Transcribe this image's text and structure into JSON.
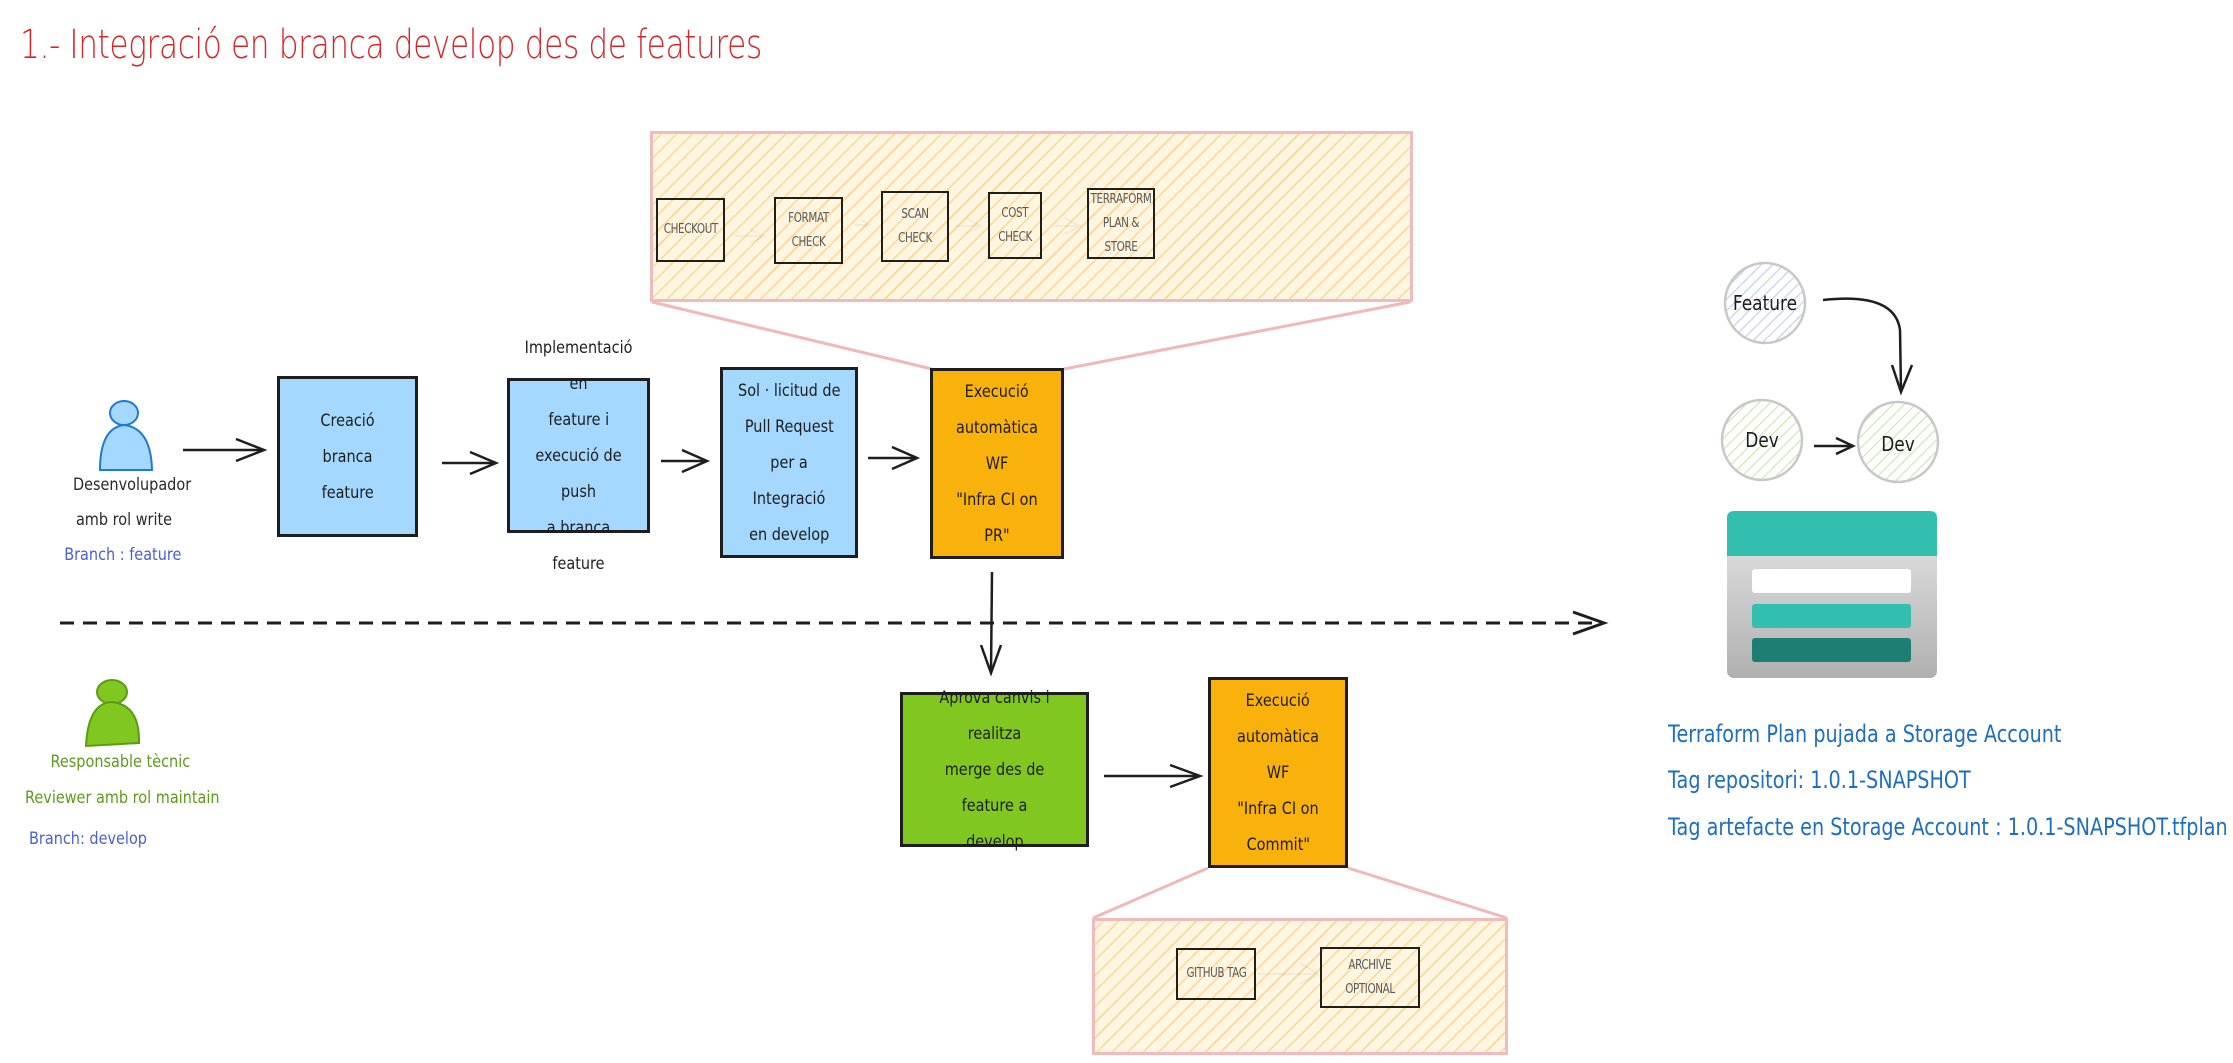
{
  "title": "1.- Integració en branca develop des de features",
  "actors": {
    "developer": {
      "line1": "Desenvolupador",
      "line2": "amb rol write",
      "branch": "Branch : feature",
      "color": "#a5d8ff"
    },
    "reviewer": {
      "line1": "Responsable tècnic",
      "line2": "Reviewer amb rol maintain",
      "branch": "Branch: develop",
      "color": "#80c81f"
    }
  },
  "flow": {
    "create_branch": [
      "Creació branca",
      "feature"
    ],
    "implement": [
      "Implementació en",
      "feature i",
      "execució de push",
      "a branca feature"
    ],
    "pull_request": [
      "Sol · licitud de",
      "Pull Request",
      "per a Integració",
      "en develop"
    ],
    "wf_pr": [
      "Execució",
      "automàtica WF",
      "\"Infra CI on",
      "PR\""
    ],
    "approve_merge": [
      "Aprova canvis i realitza",
      "merge des de feature a",
      "develop"
    ],
    "wf_commit": [
      "Execució",
      "automàtica WF",
      "\"Infra CI on",
      "Commit\""
    ]
  },
  "pr_pipeline": {
    "steps": [
      [
        "CHECKOUT"
      ],
      [
        "FORMAT CHECK"
      ],
      [
        "SCAN CHECK"
      ],
      [
        "COST",
        "CHECK"
      ],
      [
        "TERRAFORM",
        "PLAN & STORE"
      ]
    ]
  },
  "commit_pipeline": {
    "steps": [
      [
        "GITHUB TAG"
      ],
      [
        "ARCHIVE",
        "OPTIONAL"
      ]
    ]
  },
  "git_graph": {
    "feature_node": "Feature",
    "dev_node_before": "Dev",
    "dev_node_after": "Dev"
  },
  "storage_icon": "azure-storage-account-icon",
  "info": {
    "line1": "Terraform Plan pujada a Storage Account",
    "line2": "Tag repositori: 1.0.1-SNAPSHOT",
    "line3": "Tag artefacte en Storage Account : 1.0.1-SNAPSHOT.tfplan"
  },
  "colors": {
    "title": "#d0282d",
    "box_blue": "#a5d8ff",
    "box_orange": "#f9b10b",
    "box_green": "#80c81f",
    "pipeline_border": "#f0b8b8",
    "info_text": "#1f6fbf",
    "storage_teal": "#32bfb0",
    "storage_dark_teal": "#1e7e73"
  }
}
